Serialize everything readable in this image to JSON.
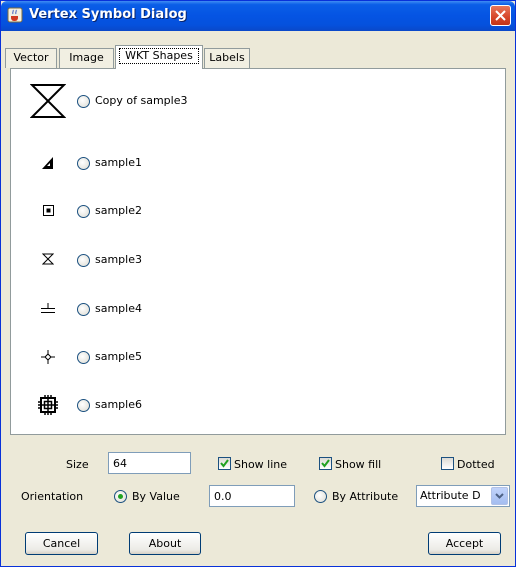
{
  "window": {
    "title": "Vertex Symbol Dialog"
  },
  "tabs": [
    {
      "label": "Vector"
    },
    {
      "label": "Image"
    },
    {
      "label": "WKT Shapes",
      "selected": true
    },
    {
      "label": "Labels"
    }
  ],
  "shapes": [
    {
      "label": "Copy of sample3",
      "icon": "hourglass-large-icon",
      "selected": false
    },
    {
      "label": "sample1",
      "icon": "triangle-icon",
      "selected": false
    },
    {
      "label": "sample2",
      "icon": "square-dot-icon",
      "selected": false
    },
    {
      "label": "sample3",
      "icon": "hourglass-icon",
      "selected": false
    },
    {
      "label": "sample4",
      "icon": "not-equal-bar-icon",
      "selected": false
    },
    {
      "label": "sample5",
      "icon": "star-cross-icon",
      "selected": false
    },
    {
      "label": "sample6",
      "icon": "grid-target-icon",
      "selected": false
    }
  ],
  "controls": {
    "size_label": "Size",
    "size_value": "64",
    "show_line_label": "Show line",
    "show_line_checked": true,
    "show_fill_label": "Show fill",
    "show_fill_checked": true,
    "dotted_label": "Dotted",
    "dotted_checked": false,
    "orientation_label": "Orientation",
    "by_value_label": "By Value",
    "by_value_selected": true,
    "orientation_value": "0.0",
    "by_attribute_label": "By Attribute",
    "by_attribute_selected": false,
    "attribute_selected": "Attribute D"
  },
  "buttons": {
    "cancel": "Cancel",
    "about": "About",
    "accept": "Accept"
  },
  "colors": {
    "titlebar": "#0554e3",
    "dialog_bg": "#ece9d8",
    "panel_bg": "#ffffff",
    "radio_checked": "#21a121"
  }
}
